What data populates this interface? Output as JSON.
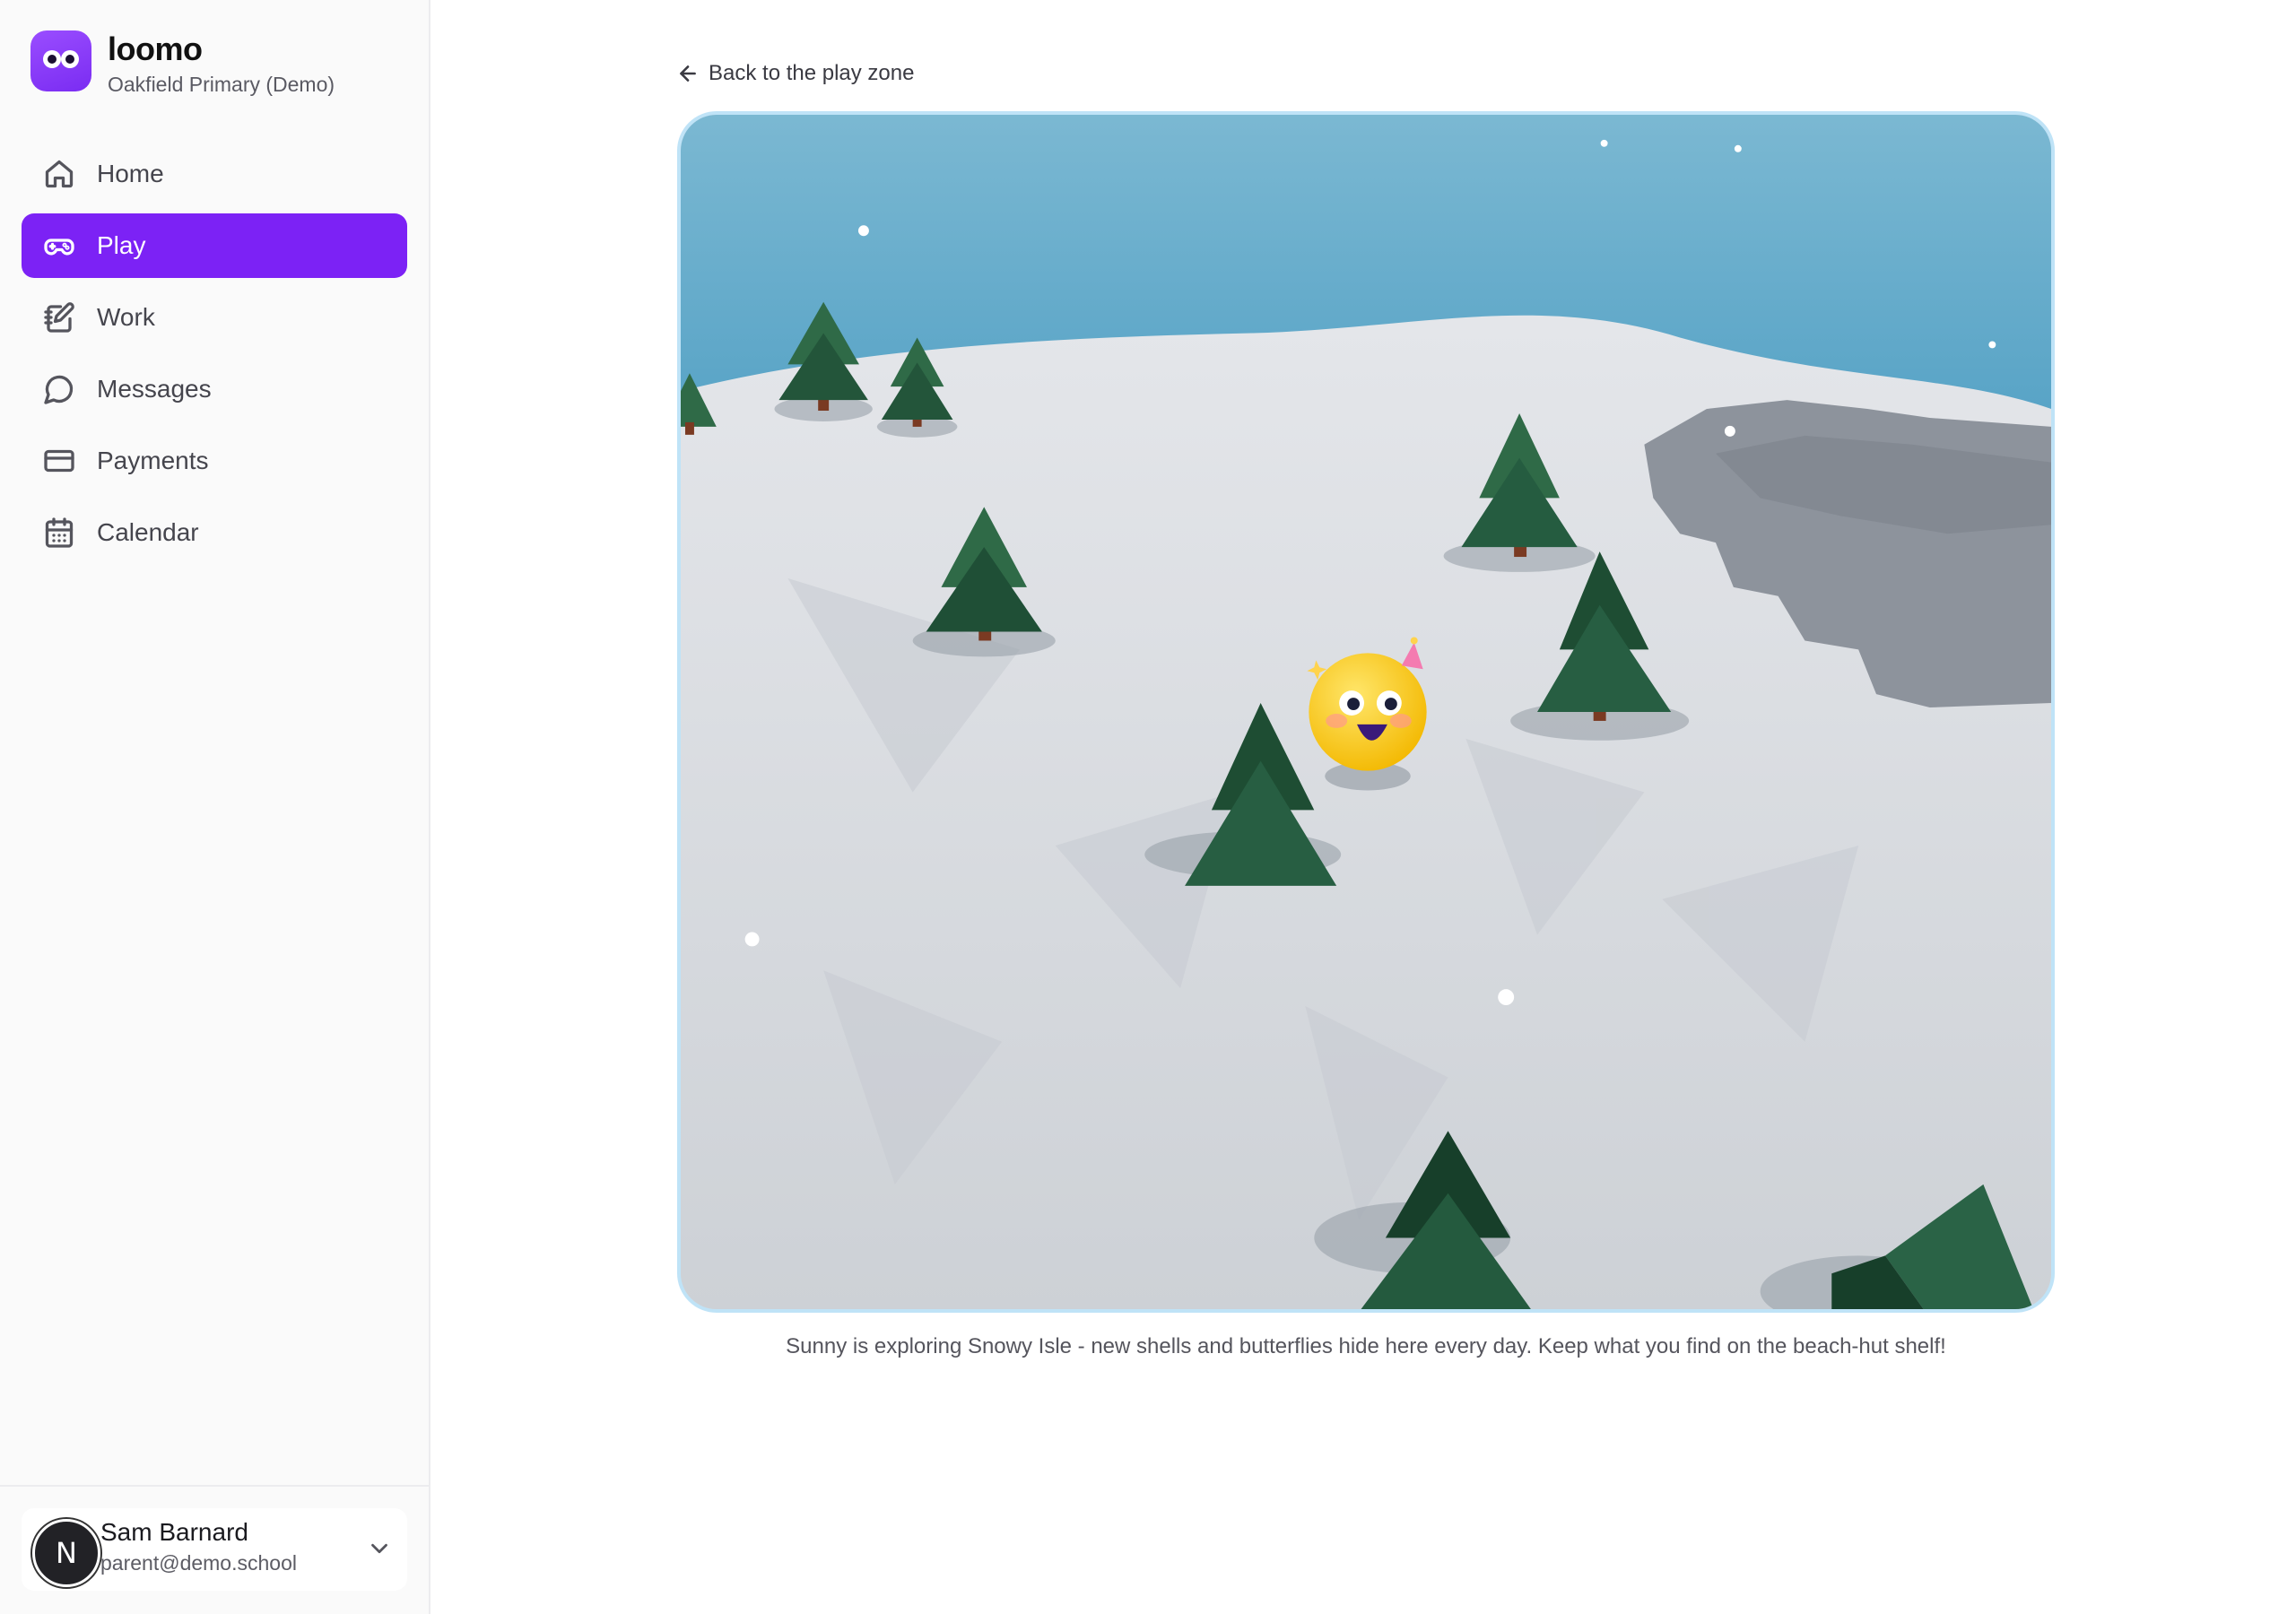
{
  "brand": {
    "name": "loomo",
    "school": "Oakfield Primary (Demo)",
    "color": "#7c22f5"
  },
  "nav": {
    "items": [
      {
        "label": "Home",
        "icon": "home-icon",
        "active": false
      },
      {
        "label": "Play",
        "icon": "gamepad-icon",
        "active": true
      },
      {
        "label": "Work",
        "icon": "notebook-pen-icon",
        "active": false
      },
      {
        "label": "Messages",
        "icon": "message-circle-icon",
        "active": false
      },
      {
        "label": "Payments",
        "icon": "credit-card-icon",
        "active": false
      },
      {
        "label": "Calendar",
        "icon": "calendar-icon",
        "active": false
      }
    ]
  },
  "user": {
    "initial": "N",
    "name": "Sam Barnard",
    "email": "parent@demo.school"
  },
  "main": {
    "back_label": "Back to the play zone",
    "caption": "Sunny is exploring Snowy Isle - new shells and butterflies hide here every day. Keep what you find on the beach-hut shelf!"
  },
  "colors": {
    "accent": "#7c22f5",
    "frame_border": "#bfe3f7",
    "water": "#5aa6c8",
    "snow": "#d5d9de",
    "tree": "#245a3e"
  }
}
